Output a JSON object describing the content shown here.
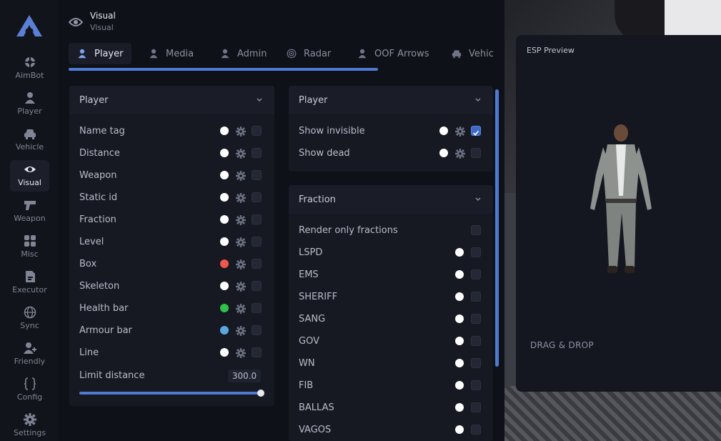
{
  "sidebar": {
    "items": [
      {
        "label": "AimBot",
        "icon": "crosshair-icon"
      },
      {
        "label": "Player",
        "icon": "person-icon"
      },
      {
        "label": "Vehicle",
        "icon": "car-icon"
      },
      {
        "label": "Visual",
        "icon": "eye-icon"
      },
      {
        "label": "Weapon",
        "icon": "gun-icon"
      },
      {
        "label": "Misc",
        "icon": "grid-icon"
      },
      {
        "label": "Executor",
        "icon": "file-icon"
      },
      {
        "label": "Sync",
        "icon": "globe-icon"
      },
      {
        "label": "Friendly",
        "icon": "person-add-icon"
      },
      {
        "label": "Config",
        "icon": "braces-icon"
      },
      {
        "label": "Settings",
        "icon": "gear-icon"
      }
    ],
    "active": "Visual"
  },
  "header": {
    "title": "Visual",
    "subtitle": "Visual",
    "icon": "eye-icon"
  },
  "tabs": [
    {
      "label": "Player",
      "icon": "person-icon"
    },
    {
      "label": "Media",
      "icon": "person-icon"
    },
    {
      "label": "Admin",
      "icon": "person-icon"
    },
    {
      "label": "Radar",
      "icon": "radar-icon"
    },
    {
      "label": "OOF Arrows",
      "icon": "person-icon"
    },
    {
      "label": "Vehic",
      "icon": "car-icon"
    }
  ],
  "player_panel": {
    "title": "Player",
    "rows": [
      {
        "label": "Name tag",
        "color": "#ffffff"
      },
      {
        "label": "Distance",
        "color": "#ffffff"
      },
      {
        "label": "Weapon",
        "color": "#ffffff"
      },
      {
        "label": "Static id",
        "color": "#ffffff"
      },
      {
        "label": "Fraction",
        "color": "#ffffff"
      },
      {
        "label": "Level",
        "color": "#ffffff"
      },
      {
        "label": "Box",
        "color": "#f0564b"
      },
      {
        "label": "Skeleton",
        "color": "#ffffff"
      },
      {
        "label": "Health bar",
        "color": "#2fc24a"
      },
      {
        "label": "Armour bar",
        "color": "#5aa6e0"
      },
      {
        "label": "Line",
        "color": "#ffffff"
      }
    ],
    "limit": {
      "label": "Limit distance",
      "value": "300.0",
      "fraction": 1.0
    }
  },
  "player2_panel": {
    "title": "Player",
    "rows": [
      {
        "label": "Show invisible",
        "color": "#ffffff",
        "checked": true
      },
      {
        "label": "Show dead",
        "color": "#ffffff",
        "checked": false
      }
    ]
  },
  "fraction_panel": {
    "title": "Fraction",
    "render_only": {
      "label": "Render only fractions",
      "checked": false
    },
    "rows": [
      {
        "label": "LSPD",
        "color": "#ffffff"
      },
      {
        "label": "EMS",
        "color": "#ffffff"
      },
      {
        "label": "SHERIFF",
        "color": "#ffffff"
      },
      {
        "label": "SANG",
        "color": "#ffffff"
      },
      {
        "label": "GOV",
        "color": "#ffffff"
      },
      {
        "label": "WN",
        "color": "#ffffff"
      },
      {
        "label": "FIB",
        "color": "#ffffff"
      },
      {
        "label": "BALLAS",
        "color": "#ffffff"
      },
      {
        "label": "VAGOS",
        "color": "#ffffff"
      }
    ]
  },
  "preview": {
    "title": "ESP Preview",
    "drag_label": "DRAG & DROP"
  },
  "colors": {
    "accent": "#4f7ad1",
    "panel": "#161922",
    "sidebar": "#12141b"
  }
}
